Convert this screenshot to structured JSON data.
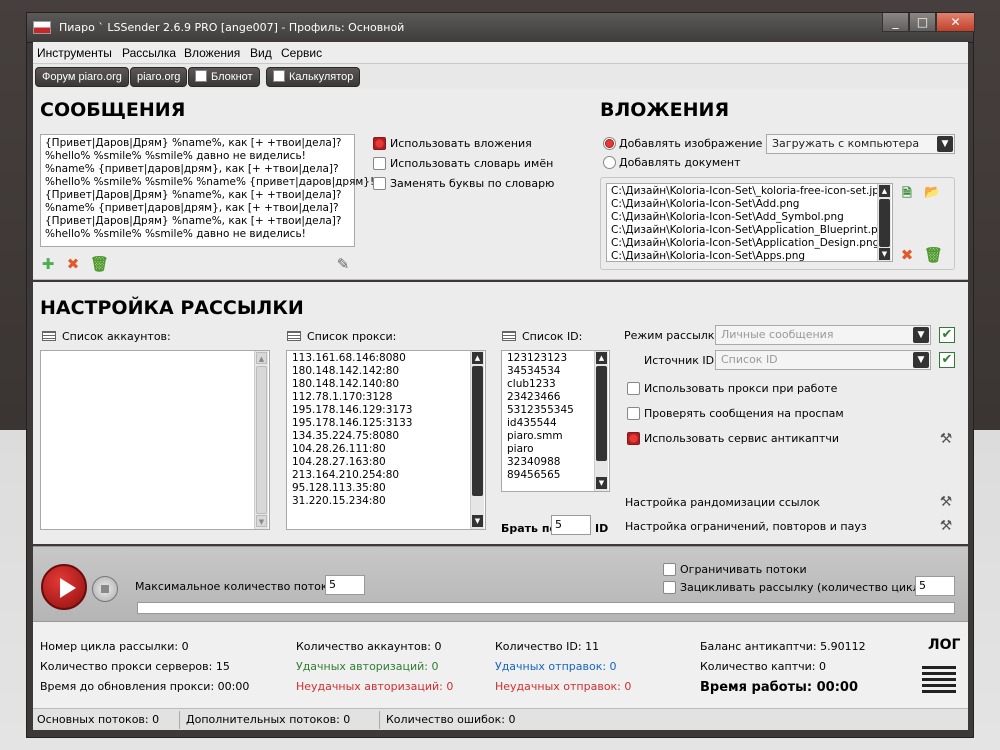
{
  "window": {
    "title": "Пиаро ` LSSender 2.6.9 PRO [ange007] - Профиль: Основной"
  },
  "menu": [
    "Инструменты",
    "Рассылка",
    "Вложения",
    "Вид",
    "Сервис"
  ],
  "quicktabs": [
    {
      "label": "Форум piaro.org",
      "icon": ""
    },
    {
      "label": "piaro.org",
      "icon": ""
    },
    {
      "label": "Блокнот",
      "icon": "notepad-icon"
    },
    {
      "label": "Калькулятор",
      "icon": "calculator-icon"
    }
  ],
  "messages": {
    "heading": "СООБЩЕНИЯ",
    "lines": [
      "{Привет|Даров|Дрям} %name%, как [+ +твои|дела]?",
      "%hello% %smile% %smile% давно не виделись!",
      "%name% {привет|даров|дрям}, как [+ +твои|дела]?",
      "%hello% %smile% %smile% %name% {привет|даров|дрям}!",
      "{Привет|Даров|Дрям} %name%, как [+ +твои|дела]?",
      "%name% {привет|даров|дрям}, как [+ +твои|дела]?",
      "{Привет|Даров|Дрям} %name%, как [+ +твои|дела]?",
      "%hello% %smile% %smile% давно не виделись!"
    ],
    "options": [
      {
        "label": "Использовать вложения",
        "checked": true
      },
      {
        "label": "Использовать словарь имён",
        "checked": false
      },
      {
        "label": "Заменять буквы по словарю",
        "checked": false
      }
    ]
  },
  "attachments": {
    "heading": "ВЛОЖЕНИЯ",
    "add_image": "Добавлять изображение",
    "add_document": "Добавлять документ",
    "source": "Загружать с компьютера",
    "files": [
      "C:\\Дизайн\\Koloria-Icon-Set\\_koloria-free-icon-set.jpg",
      "C:\\Дизайн\\Koloria-Icon-Set\\Add.png",
      "C:\\Дизайн\\Koloria-Icon-Set\\Add_Symbol.png",
      "C:\\Дизайн\\Koloria-Icon-Set\\Application_Blueprint.png",
      "C:\\Дизайн\\Koloria-Icon-Set\\Application_Design.png",
      "C:\\Дизайн\\Koloria-Icon-Set\\Apps.png"
    ]
  },
  "mailing": {
    "heading": "НАСТРОЙКА РАССЫЛКИ",
    "accounts_label": "Список аккаунтов:",
    "proxy_label": "Список прокси:",
    "proxies": [
      "113.161.68.146:8080",
      "180.148.142.142:80",
      "180.148.142.140:80",
      "112.78.1.170:3128",
      "195.178.146.129:3173",
      "195.178.146.125:3133",
      "134.35.224.75:8080",
      "104.28.26.111:80",
      "104.28.27.163:80",
      "213.164.210.254:80",
      "95.128.113.35:80",
      "31.220.15.234:80"
    ],
    "id_label": "Список ID:",
    "ids": [
      "123123123",
      "34534534",
      "club1233",
      "23423466",
      "5312355345",
      "id435544",
      "piaro.smm",
      "piaro",
      "32340988",
      "89456565"
    ],
    "take_by_label": "Брать по",
    "take_by_value": "5",
    "take_by_unit": "ID",
    "mode_label": "Режим рассылки:",
    "mode_value": "Личные сообщения",
    "source_label": "Источник ID:",
    "source_value": "Список ID",
    "opts": [
      {
        "label": "Использовать прокси при работе",
        "checked": false
      },
      {
        "label": "Проверять сообщения на проспам",
        "checked": false
      },
      {
        "label": "Использовать сервис антикаптчи",
        "checked": true
      }
    ],
    "rand_links": "Настройка рандомизации ссылок",
    "limits": "Настройка ограничений, повторов и пауз"
  },
  "run": {
    "max_threads_label": "Максимальное количество потоков:",
    "max_threads": "5",
    "limit_threads": "Ограничивать потоки",
    "loop_label": "Зацикливать рассылку (количество циклов):",
    "loop_value": "5"
  },
  "stats": {
    "cycle": "Номер цикла рассылки: 0",
    "proxy_count": "Количество прокси серверов: 15",
    "proxy_refresh": "Время до обновления прокси: 00:00",
    "accounts": "Количество аккаунтов: 0",
    "auth_ok": "Удачных авторизаций: 0",
    "auth_fail": "Неудачных авторизаций: 0",
    "ids": "Количество ID: 11",
    "sent_ok": "Удачных отправок: 0",
    "sent_fail": "Неудачных отправок: 0",
    "balance": "Баланс антикаптчи: 5.90112",
    "captchas": "Количество каптчи: 0",
    "uptime": "Время работы: 00:00",
    "log": "ЛОГ"
  },
  "status": {
    "main_threads": "Основных потоков: 0",
    "extra_threads": "Дополнительных потоков: 0",
    "errors": "Количество ошибок: 0"
  }
}
